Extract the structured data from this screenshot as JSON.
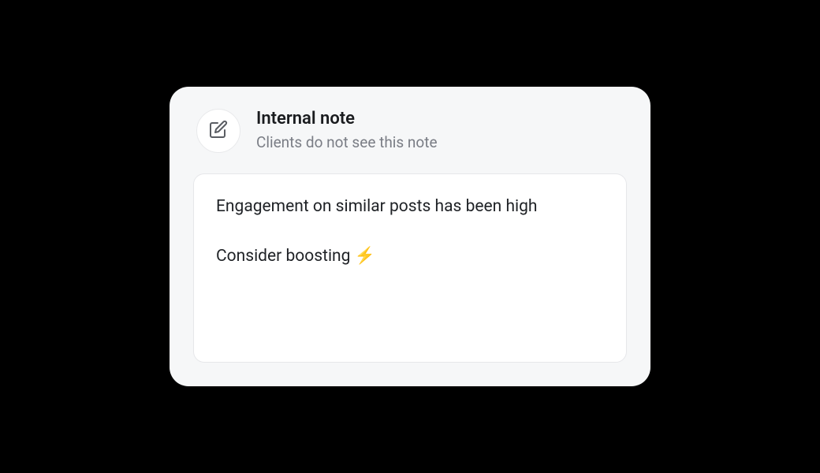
{
  "card": {
    "title": "Internal note",
    "subtitle": "Clients do not see this note",
    "body": "Engagement on similar posts has been high\n\nConsider boosting ⚡"
  }
}
